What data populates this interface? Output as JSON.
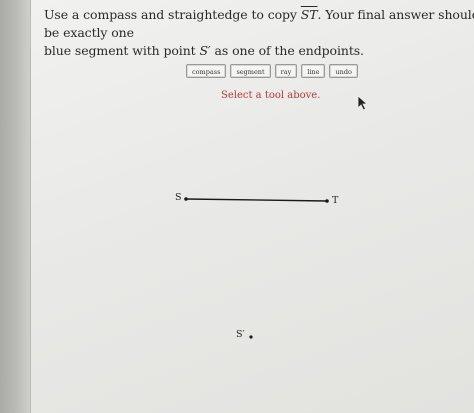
{
  "prompt": {
    "line1_prefix": "Use a compass and straightedge to copy ",
    "segment_name": "ST",
    "line1_suffix": ". Your final answer should be exactly one",
    "line2_prefix": "blue segment with point ",
    "point_name": "S′",
    "line2_suffix": " as one of the endpoints."
  },
  "toolbar": {
    "tools": [
      "compass",
      "segment",
      "ray",
      "line",
      "undo"
    ]
  },
  "status_text": "Select a tool above.",
  "canvas": {
    "point_s_label": "S",
    "point_t_label": "T",
    "point_s_prime_label": "S′"
  },
  "colors": {
    "status": "#b33a3a",
    "segment": "#1a1a1a"
  },
  "icons": {
    "cursor": "arrow-cursor-icon"
  }
}
